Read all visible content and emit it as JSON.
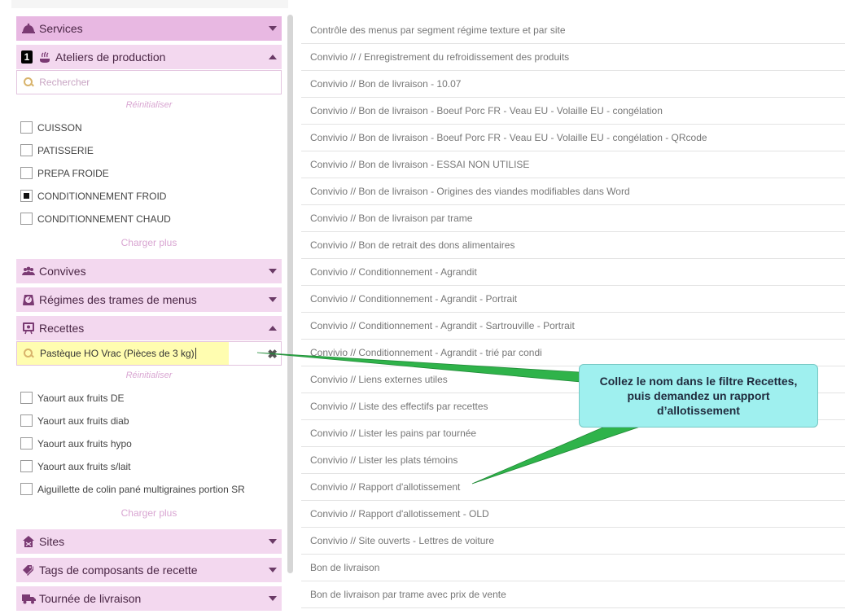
{
  "sidebar": {
    "sections": {
      "services": "Services",
      "ateliers": "Ateliers de production",
      "ateliers_count": "1",
      "convives": "Convives",
      "regimes": "Régimes des trames de menus",
      "recettes": "Recettes",
      "sites": "Sites",
      "tags": "Tags de composants de recette",
      "tournee": "Tournée de livraison"
    },
    "ateliers_search_placeholder": "Rechercher",
    "reset_label": "Réinitialiser",
    "load_more_label": "Charger plus",
    "ateliers_items": [
      {
        "label": "CUISSON",
        "checked": false
      },
      {
        "label": "PATISSERIE",
        "checked": false
      },
      {
        "label": "PREPA FROIDE",
        "checked": false
      },
      {
        "label": "CONDITIONNEMENT FROID",
        "checked": true
      },
      {
        "label": "CONDITIONNEMENT CHAUD",
        "checked": false
      }
    ],
    "recettes_search_value": "Pastèque HO Vrac (Pièces de 3 kg)",
    "recettes_items": [
      {
        "label": "Yaourt aux fruits DE",
        "checked": false
      },
      {
        "label": "Yaourt aux fruits diab",
        "checked": false
      },
      {
        "label": "Yaourt aux fruits hypo",
        "checked": false
      },
      {
        "label": "Yaourt aux fruits s/lait",
        "checked": false
      },
      {
        "label": "Aiguillette de colin pané multigraines portion SR",
        "checked": false
      }
    ]
  },
  "reports": [
    "Contrôle des menus par segment régime texture et par site",
    "Convivio // / Enregistrement du refroidissement des produits",
    "Convivio // Bon de livraison - 10.07",
    "Convivio // Bon de livraison - Boeuf Porc FR - Veau EU - Volaille EU - congélation",
    "Convivio // Bon de livraison - Boeuf Porc FR - Veau EU - Volaille EU - congélation - QRcode",
    "Convivio // Bon de livraison - ESSAI NON UTILISE",
    "Convivio // Bon de livraison - Origines des viandes modifiables dans Word",
    "Convivio // Bon de livraison par trame",
    "Convivio // Bon de retrait des dons alimentaires",
    "Convivio // Conditionnement - Agrandit",
    "Convivio // Conditionnement - Agrandit - Portrait",
    "Convivio // Conditionnement - Agrandit - Sartrouville - Portrait",
    "Convivio // Conditionnement - Agrandit - trié par condi",
    "Convivio // Liens externes utiles",
    "Convivio // Liste des effectifs par recettes",
    "Convivio // Lister les pains par tournée",
    "Convivio // Lister les plats témoins",
    "Convivio // Rapport d'allotissement",
    "Convivio // Rapport d'allotissement - OLD",
    "Convivio // Site ouverts - Lettres de voiture",
    "Bon de livraison",
    "Bon de livraison par trame avec prix de vente"
  ],
  "callout": {
    "text": "Collez le nom dans le filtre Recettes, puis demandez un rapport d’allotissement"
  },
  "colors": {
    "section_bg": "#f3d8ef",
    "section_active_bg": "#e8b8e2",
    "callout_bg": "#9ff0ef",
    "arrow": "#2fb34a"
  }
}
